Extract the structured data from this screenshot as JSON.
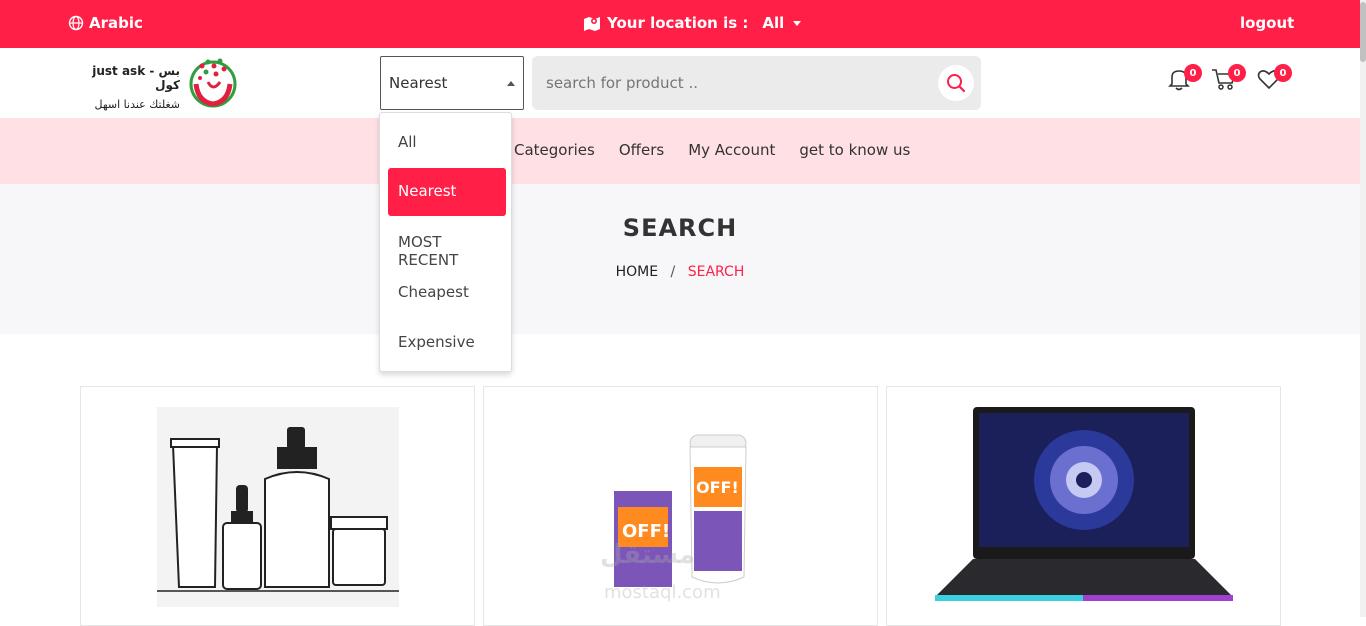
{
  "topbar": {
    "language_label": "Arabic",
    "location_label": "Your location is :",
    "location_value": "All",
    "logout_label": "logout"
  },
  "brand": {
    "name_line1": "just ask - بس كول",
    "name_line2": "شغلتك عندنا اسهل"
  },
  "sort": {
    "selected": "Nearest",
    "options": [
      "All",
      "Nearest",
      "MOST RECENT",
      "Cheapest",
      "Expensive"
    ]
  },
  "search": {
    "placeholder": "search for product .."
  },
  "header_icons": {
    "notifications_count": "0",
    "cart_count": "0",
    "wishlist_count": "0"
  },
  "nav": {
    "items": [
      "Categories",
      "Offers",
      "My Account",
      "get to know us"
    ]
  },
  "banner": {
    "title": "SEARCH",
    "breadcrumb_home": "HOME",
    "breadcrumb_sep": "/",
    "breadcrumb_current": "SEARCH"
  },
  "products": [
    {
      "image": "skincare-bottles-sketch"
    },
    {
      "image": "off-kids-repellent-lotion"
    },
    {
      "image": "msi-laptop"
    }
  ],
  "watermark": {
    "text": "مستقل",
    "url": "mostaql.com"
  },
  "colors": {
    "accent": "#ff1f47",
    "nav_bg": "#ffe0e4",
    "banner_bg": "#f7f7fa"
  }
}
